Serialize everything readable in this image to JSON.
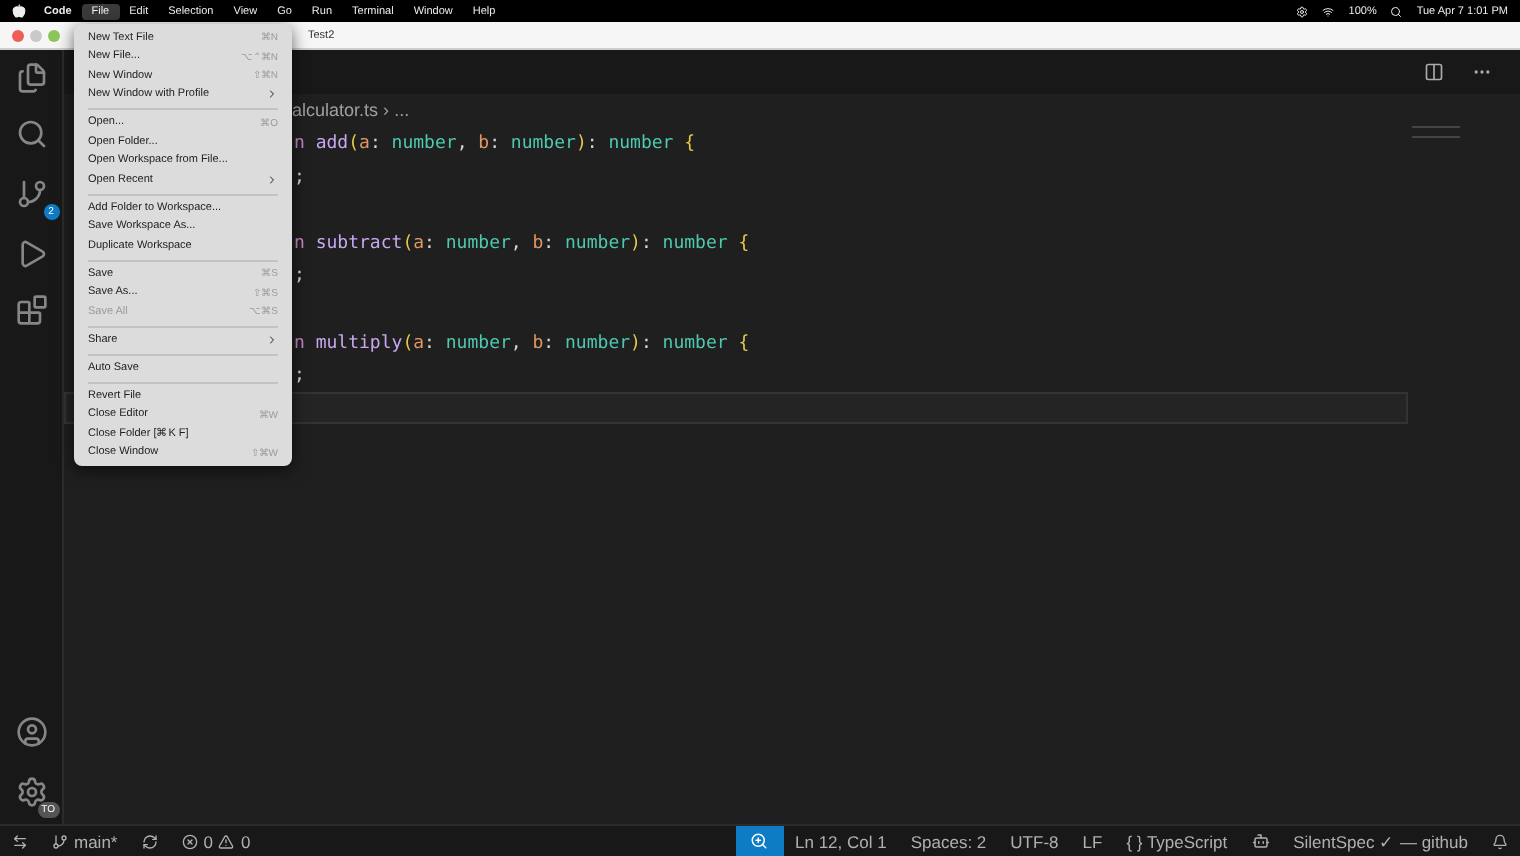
{
  "menu_bar": {
    "app": "Code",
    "items": [
      {
        "label": "File",
        "selected": true
      },
      {
        "label": "Edit",
        "selected": false
      },
      {
        "label": "Selection",
        "selected": false
      },
      {
        "label": "View",
        "selected": false
      },
      {
        "label": "Go",
        "selected": false
      },
      {
        "label": "Run",
        "selected": false
      },
      {
        "label": "Terminal",
        "selected": false
      },
      {
        "label": "Window",
        "selected": false
      },
      {
        "label": "Help",
        "selected": false
      }
    ],
    "battery": "100%",
    "clock": "Tue Apr 7  1:01 PM"
  },
  "window": {
    "title": "Test2"
  },
  "activity_bar": {
    "source_control_badge": "2",
    "account_badge": "TO"
  },
  "breadcrumb": {
    "file": "alculator.ts",
    "separator": "›",
    "more": "..."
  },
  "code_lines": [
    {
      "current": false,
      "tokens": [
        {
          "kind": "keyword",
          "text": "n"
        },
        {
          "kind": "fn",
          "text": " add"
        },
        {
          "kind": "punct",
          "text": "("
        },
        {
          "kind": "param",
          "text": "a"
        },
        {
          "kind": "plain",
          "text": ": "
        },
        {
          "kind": "type",
          "text": "number"
        },
        {
          "kind": "plain",
          "text": ", "
        },
        {
          "kind": "param",
          "text": "b"
        },
        {
          "kind": "plain",
          "text": ": "
        },
        {
          "kind": "type",
          "text": "number"
        },
        {
          "kind": "punct",
          "text": ")"
        },
        {
          "kind": "plain",
          "text": ": "
        },
        {
          "kind": "type",
          "text": "number"
        },
        {
          "kind": "punct",
          "text": " {"
        }
      ]
    },
    {
      "current": false,
      "tokens": [
        {
          "kind": "plain",
          "text": ";"
        }
      ]
    },
    {
      "current": false
    },
    {
      "current": false,
      "tokens": [
        {
          "kind": "keyword",
          "text": "n"
        },
        {
          "kind": "fn",
          "text": " subtract"
        },
        {
          "kind": "punct",
          "text": "("
        },
        {
          "kind": "param",
          "text": "a"
        },
        {
          "kind": "plain",
          "text": ": "
        },
        {
          "kind": "type",
          "text": "number"
        },
        {
          "kind": "plain",
          "text": ", "
        },
        {
          "kind": "param",
          "text": "b"
        },
        {
          "kind": "plain",
          "text": ": "
        },
        {
          "kind": "type",
          "text": "number"
        },
        {
          "kind": "punct",
          "text": ")"
        },
        {
          "kind": "plain",
          "text": ": "
        },
        {
          "kind": "type",
          "text": "number"
        },
        {
          "kind": "punct",
          "text": " {"
        }
      ]
    },
    {
      "current": false,
      "tokens": [
        {
          "kind": "plain",
          "text": ";"
        }
      ]
    },
    {
      "current": false
    },
    {
      "current": false,
      "tokens": [
        {
          "kind": "keyword",
          "text": "n"
        },
        {
          "kind": "fn",
          "text": " multiply"
        },
        {
          "kind": "punct",
          "text": "("
        },
        {
          "kind": "param",
          "text": "a"
        },
        {
          "kind": "plain",
          "text": ": "
        },
        {
          "kind": "type",
          "text": "number"
        },
        {
          "kind": "plain",
          "text": ", "
        },
        {
          "kind": "param",
          "text": "b"
        },
        {
          "kind": "plain",
          "text": ": "
        },
        {
          "kind": "type",
          "text": "number"
        },
        {
          "kind": "punct",
          "text": ")"
        },
        {
          "kind": "plain",
          "text": ": "
        },
        {
          "kind": "type",
          "text": "number"
        },
        {
          "kind": "punct",
          "text": " {"
        }
      ]
    },
    {
      "current": false,
      "tokens": [
        {
          "kind": "plain",
          "text": ";"
        }
      ]
    },
    {
      "current": true
    }
  ],
  "file_menu": [
    {
      "kind": "item",
      "label": "New Text File",
      "shortcut": "⌘N",
      "submenu": false,
      "disabled": false
    },
    {
      "kind": "item",
      "label": "New File...",
      "shortcut": "⌥⌃⌘N",
      "submenu": false,
      "disabled": false
    },
    {
      "kind": "item",
      "label": "New Window",
      "shortcut": "⇧⌘N",
      "submenu": false,
      "disabled": false
    },
    {
      "kind": "item",
      "label": "New Window with Profile",
      "submenu": true,
      "disabled": false
    },
    {
      "kind": "separator"
    },
    {
      "kind": "item",
      "label": "Open...",
      "shortcut": "⌘O",
      "submenu": false,
      "disabled": false
    },
    {
      "kind": "item",
      "label": "Open Folder...",
      "submenu": false,
      "disabled": false
    },
    {
      "kind": "item",
      "label": "Open Workspace from File...",
      "submenu": false,
      "disabled": false
    },
    {
      "kind": "item",
      "label": "Open Recent",
      "submenu": true,
      "disabled": false
    },
    {
      "kind": "separator"
    },
    {
      "kind": "item",
      "label": "Add Folder to Workspace...",
      "submenu": false,
      "disabled": false
    },
    {
      "kind": "item",
      "label": "Save Workspace As...",
      "submenu": false,
      "disabled": false
    },
    {
      "kind": "item",
      "label": "Duplicate Workspace",
      "submenu": false,
      "disabled": false
    },
    {
      "kind": "separator"
    },
    {
      "kind": "item",
      "label": "Save",
      "shortcut": "⌘S",
      "submenu": false,
      "disabled": false
    },
    {
      "kind": "item",
      "label": "Save As...",
      "shortcut": "⇧⌘S",
      "submenu": false,
      "disabled": false
    },
    {
      "kind": "item",
      "label": "Save All",
      "shortcut": "⌥⌘S",
      "submenu": false,
      "disabled": true
    },
    {
      "kind": "separator"
    },
    {
      "kind": "item",
      "label": "Share",
      "submenu": true,
      "disabled": false
    },
    {
      "kind": "separator"
    },
    {
      "kind": "item",
      "label": "Auto Save",
      "submenu": false,
      "disabled": false
    },
    {
      "kind": "separator"
    },
    {
      "kind": "item",
      "label": "Revert File",
      "submenu": false,
      "disabled": false
    },
    {
      "kind": "item",
      "label": "Close Editor",
      "shortcut": "⌘W",
      "submenu": false,
      "disabled": false
    },
    {
      "kind": "item",
      "label": "Close Folder [⌘K F]",
      "submenu": false,
      "disabled": false
    },
    {
      "kind": "item",
      "label": "Close Window",
      "shortcut": "⇧⌘W",
      "submenu": false,
      "disabled": false
    }
  ],
  "status_bar": {
    "branch": "main*",
    "errors": "0",
    "warnings": "0",
    "position": "Ln 12, Col 1",
    "spaces": "Spaces: 2",
    "encoding": "UTF-8",
    "eol": "LF",
    "language_icon": "{ }",
    "language": "TypeScript",
    "account": "SilentSpec ✓ — github"
  }
}
